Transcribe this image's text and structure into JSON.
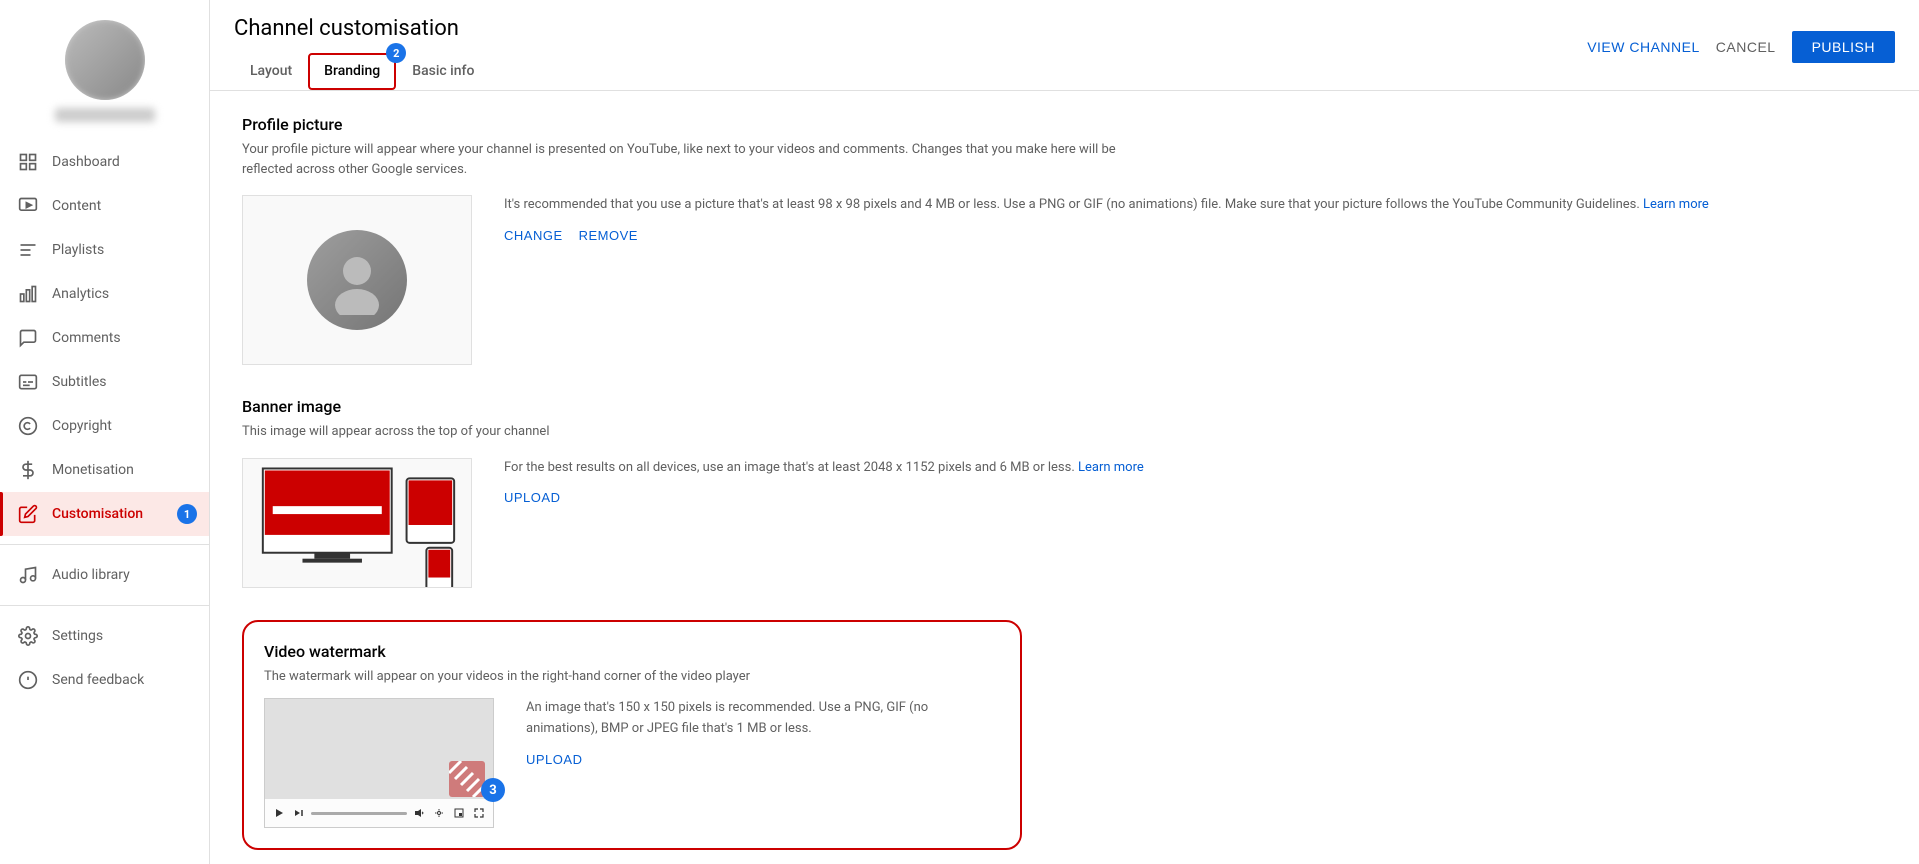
{
  "sidebar": {
    "items": [
      {
        "id": "dashboard",
        "label": "Dashboard",
        "icon": "⊞"
      },
      {
        "id": "content",
        "label": "Content",
        "icon": "▶"
      },
      {
        "id": "playlists",
        "label": "Playlists",
        "icon": "☰"
      },
      {
        "id": "analytics",
        "label": "Analytics",
        "icon": "▦"
      },
      {
        "id": "comments",
        "label": "Comments",
        "icon": "💬"
      },
      {
        "id": "subtitles",
        "label": "Subtitles",
        "icon": "⌨"
      },
      {
        "id": "copyright",
        "label": "Copyright",
        "icon": "©"
      },
      {
        "id": "monetisation",
        "label": "Monetisation",
        "icon": "$"
      },
      {
        "id": "customisation",
        "label": "Customisation",
        "icon": "✏"
      }
    ],
    "bottom_items": [
      {
        "id": "audio-library",
        "label": "Audio library",
        "icon": "🎵"
      },
      {
        "id": "settings",
        "label": "Settings",
        "icon": "⚙"
      },
      {
        "id": "send-feedback",
        "label": "Send feedback",
        "icon": "!"
      }
    ]
  },
  "header": {
    "title": "Channel customisation",
    "tabs": [
      {
        "id": "layout",
        "label": "Layout",
        "active": false
      },
      {
        "id": "branding",
        "label": "Branding",
        "active": true
      },
      {
        "id": "basic-info",
        "label": "Basic info",
        "active": false
      }
    ],
    "actions": {
      "view_channel": "VIEW CHANNEL",
      "cancel": "CANCEL",
      "publish": "PUBLISH"
    }
  },
  "sections": {
    "profile_picture": {
      "title": "Profile picture",
      "description": "Your profile picture will appear where your channel is presented on YouTube, like next to your videos and comments. Changes that you make here will be reflected across other Google services.",
      "info": "It's recommended that you use a picture that's at least 98 x 98 pixels and 4 MB or less. Use a PNG or GIF (no animations) file. Make sure that your picture follows the YouTube Community Guidelines.",
      "learn_more": "Learn more",
      "change_btn": "CHANGE",
      "remove_btn": "REMOVE"
    },
    "banner_image": {
      "title": "Banner image",
      "description": "This image will appear across the top of your channel",
      "info": "For the best results on all devices, use an image that's at least 2048 x 1152 pixels and 6 MB or less.",
      "learn_more": "Learn more",
      "upload_btn": "UPLOAD"
    },
    "video_watermark": {
      "title": "Video watermark",
      "description": "The watermark will appear on your videos in the right-hand corner of the video player",
      "info": "An image that's 150 x 150 pixels is recommended. Use a PNG, GIF (no animations), BMP or JPEG file that's 1 MB or less.",
      "upload_btn": "UPLOAD"
    }
  },
  "badges": {
    "badge_1": "1",
    "badge_2": "2",
    "badge_3": "3"
  }
}
